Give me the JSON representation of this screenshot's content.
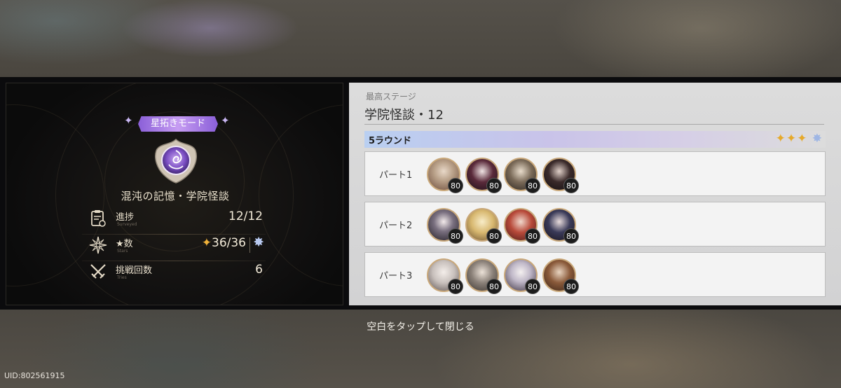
{
  "left_panel": {
    "mode_label": "星拓きモード",
    "stage_name": "混沌の記憶・学院怪談",
    "stats": [
      {
        "label": "進捗",
        "sub": "Surveyed",
        "value": "12/12",
        "icon": "clipboard-icon"
      },
      {
        "label": "★数",
        "sub": "Stars",
        "value": "36/36",
        "icon": "star-compass-icon"
      },
      {
        "label": "挑戦回数",
        "sub": "Tries",
        "value": "6",
        "icon": "crossed-swords-icon"
      }
    ]
  },
  "right_panel": {
    "best_label": "最高ステージ",
    "best_stage": "学院怪談・12",
    "round_label": "5ラウンド",
    "round_stars": "✦✦✦",
    "parts": [
      {
        "label": "パート1",
        "levels": [
          "80",
          "80",
          "80",
          "80"
        ]
      },
      {
        "label": "パート2",
        "levels": [
          "80",
          "80",
          "80",
          "80"
        ]
      },
      {
        "label": "パート3",
        "levels": [
          "80",
          "80",
          "80",
          "80"
        ]
      }
    ]
  },
  "close_hint": "空白をタップして閉じる",
  "uid": "UID:802561915",
  "colors": {
    "accent_purple": "#8a5fd8",
    "star_gold": "#e6a92a",
    "panel_light": "#dcdcdc"
  }
}
